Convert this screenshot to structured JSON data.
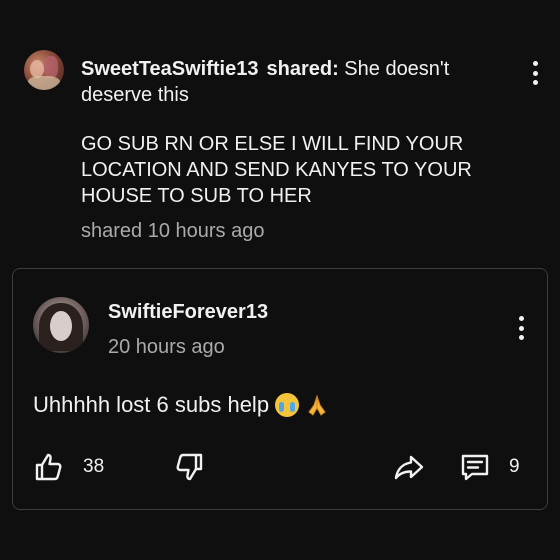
{
  "share": {
    "author": "SweetTeaSwiftie13",
    "shared_label": "shared:",
    "caption_line1": "She doesn't",
    "caption_line2": "deserve this",
    "body": "GO SUB RN OR ELSE I WILL FIND YOUR LOCATION AND SEND KANYES TO YOUR HOUSE TO SUB TO HER",
    "timestamp": "shared 10 hours ago"
  },
  "post": {
    "author": "SwiftieForever13",
    "timestamp": "20 hours ago",
    "text": "Uhhhhh lost 6 subs help",
    "emojis": [
      "loudly-crying-face",
      "folded-hands"
    ],
    "like_count": "38",
    "comment_count": "9"
  },
  "icons": {
    "share_menu": "more-vert-icon",
    "post_menu": "more-vert-icon",
    "like": "thumb-up-icon",
    "dislike": "thumb-down-icon",
    "share": "share-arrow-icon",
    "comment": "comment-icon"
  },
  "colors": {
    "background": "#0f0f0f",
    "text": "#f1f1f1",
    "secondary_text": "#aaaaaa",
    "card_border": "#3d3d3d"
  }
}
